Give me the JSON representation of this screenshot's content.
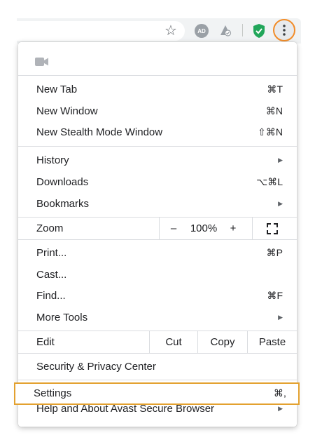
{
  "toolbar": {
    "bookmark_icon": "star-icon",
    "adblock_badge": "AD",
    "extension_icons": [
      "adblock-icon",
      "privacy-extension-icon",
      "shield-check-icon"
    ],
    "more_icon": "more-vertical-icon",
    "shield_color": "#21a65a",
    "more_button_ring": "#f28c28"
  },
  "menu": {
    "camera_icon": "video-camera-icon",
    "group1": [
      {
        "label": "New Tab",
        "shortcut": "⌘T"
      },
      {
        "label": "New Window",
        "shortcut": "⌘N"
      },
      {
        "label": "New Stealth Mode Window",
        "shortcut": "⇧⌘N"
      }
    ],
    "group2": [
      {
        "label": "History",
        "shortcut": "",
        "submenu": true
      },
      {
        "label": "Downloads",
        "shortcut": "⌥⌘L"
      },
      {
        "label": "Bookmarks",
        "shortcut": "",
        "submenu": true
      }
    ],
    "zoom": {
      "label": "Zoom",
      "minus": "–",
      "value": "100%",
      "plus": "+",
      "fullscreen_icon": "fullscreen-icon"
    },
    "group3": [
      {
        "label": "Print...",
        "shortcut": "⌘P"
      },
      {
        "label": "Cast...",
        "shortcut": ""
      },
      {
        "label": "Find...",
        "shortcut": "⌘F"
      },
      {
        "label": "More Tools",
        "shortcut": "",
        "submenu": true
      }
    ],
    "edit": {
      "label": "Edit",
      "cut": "Cut",
      "copy": "Copy",
      "paste": "Paste"
    },
    "security": {
      "label": "Security & Privacy Center"
    },
    "settings": {
      "label": "Settings",
      "shortcut": "⌘,"
    },
    "help": {
      "label": "Help and About Avast Secure Browser",
      "submenu": true
    },
    "highlight_color": "#e3a12f"
  }
}
